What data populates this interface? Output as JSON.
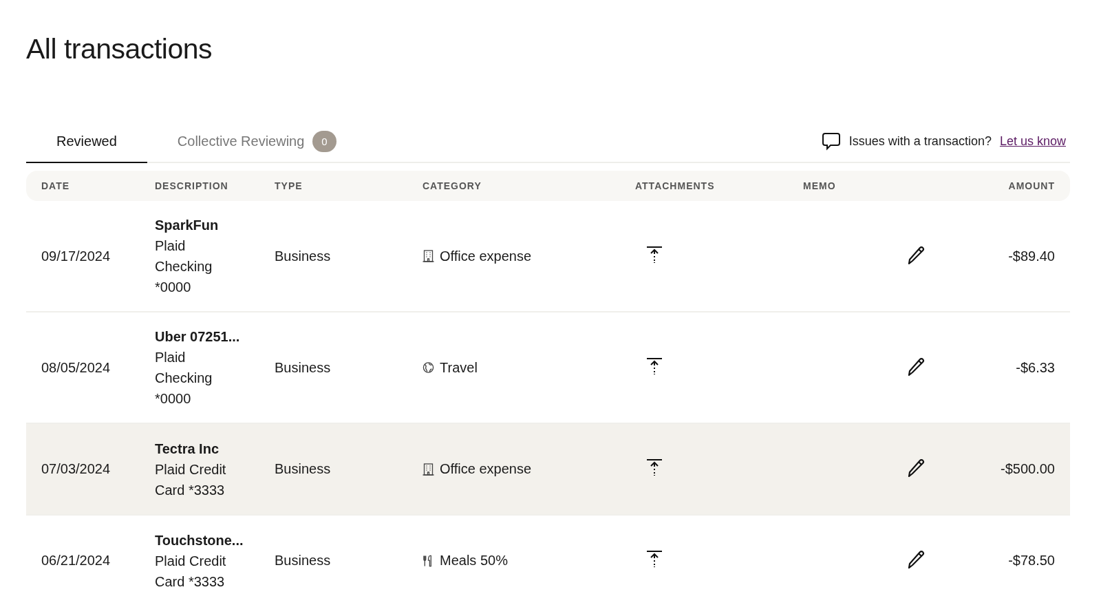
{
  "title": "All transactions",
  "tabs": [
    {
      "label": "Reviewed",
      "selected": true
    },
    {
      "label": "Collective Reviewing",
      "badge": "0",
      "selected": false
    }
  ],
  "feedback": {
    "text": "Issues with a transaction?",
    "link": "Let us know"
  },
  "table": {
    "columns": [
      "DATE",
      "DESCRIPTION",
      "TYPE",
      "CATEGORY",
      "ATTACHMENTS",
      "MEMO",
      "AMOUNT"
    ],
    "rows": [
      {
        "date": "09/17/2024",
        "name": "SparkFun",
        "account": "Plaid Checking *0000",
        "type": "Business",
        "category": {
          "kind": "office",
          "label": "Office expense"
        },
        "amount": "-$89.40",
        "selected": false
      },
      {
        "date": "08/05/2024",
        "name": "Uber 07251...",
        "account": "Plaid Checking *0000",
        "type": "Business",
        "category": {
          "kind": "travel",
          "label": "Travel"
        },
        "amount": "-$6.33",
        "selected": false
      },
      {
        "date": "07/03/2024",
        "name": "Tectra Inc",
        "account": "Plaid Credit Card *3333",
        "type": "Business",
        "category": {
          "kind": "office",
          "label": "Office expense"
        },
        "amount": "-$500.00",
        "selected": true
      },
      {
        "date": "06/21/2024",
        "name": "Touchstone...",
        "account": "Plaid Credit Card *3333",
        "type": "Business",
        "category": {
          "kind": "meals",
          "label": "Meals 50%"
        },
        "amount": "-$78.50",
        "selected": false
      }
    ]
  }
}
